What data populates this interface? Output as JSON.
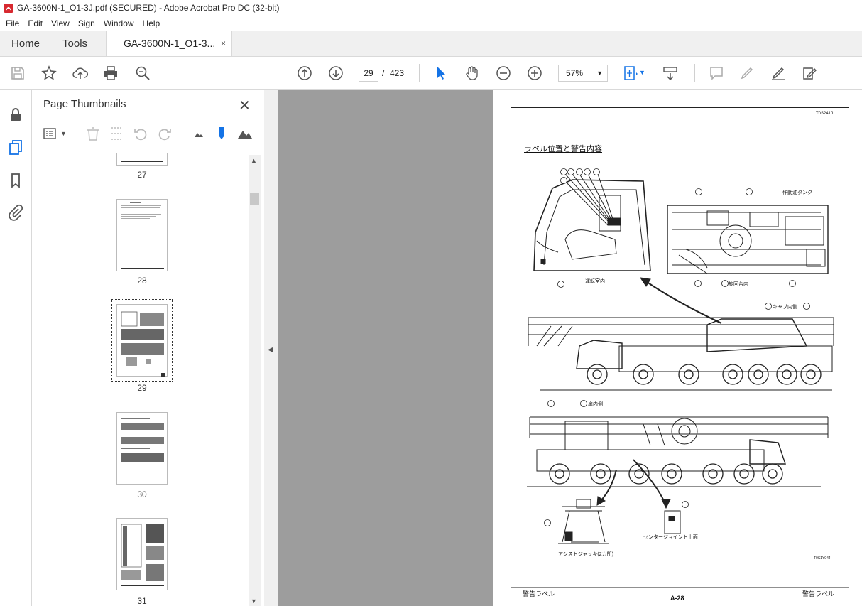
{
  "window": {
    "title": "GA-3600N-1_O1-3J.pdf (SECURED) - Adobe Acrobat Pro DC (32-bit)"
  },
  "menu": [
    "File",
    "Edit",
    "View",
    "Sign",
    "Window",
    "Help"
  ],
  "tabs": {
    "home": "Home",
    "tools": "Tools",
    "document": "GA-3600N-1_O1-3...",
    "close": "×"
  },
  "toolbar": {
    "current_page": "29",
    "page_separator": "/",
    "total_pages": "423",
    "zoom": "57%"
  },
  "thumbnails_panel": {
    "title": "Page Thumbnails",
    "close": "✕",
    "pages": [
      {
        "num": "27"
      },
      {
        "num": "28"
      },
      {
        "num": "29",
        "selected": true
      },
      {
        "num": "30"
      },
      {
        "num": "31"
      }
    ]
  },
  "document_page": {
    "code": "T0S241J",
    "section_title": "ラベル位置と警告内容",
    "labels": {
      "hydraulic_tank": "作動油タンク",
      "cab_interior": "運転室内",
      "swivel_interior": "旋回台内",
      "cab_inside": "キャブ内側",
      "door_inside": "扉内側",
      "center_joint": "センタージョイント上面",
      "assist_jack": "アシストジャッキ(2カ所)",
      "figure_code": "T0S1Y04J"
    },
    "callouts": [
      "1",
      "2",
      "3",
      "4",
      "7",
      "5",
      "8",
      "9",
      "10",
      "11",
      "12",
      "13",
      "14",
      "15",
      "24",
      "20",
      "6"
    ],
    "footer_left": "警告ラベル",
    "footer_center": "A-28",
    "footer_right": "警告ラベル"
  },
  "colors": {
    "accent_blue": "#1473e6",
    "pdf_red": "#d7282f",
    "gray_bg": "#9d9d9d"
  }
}
